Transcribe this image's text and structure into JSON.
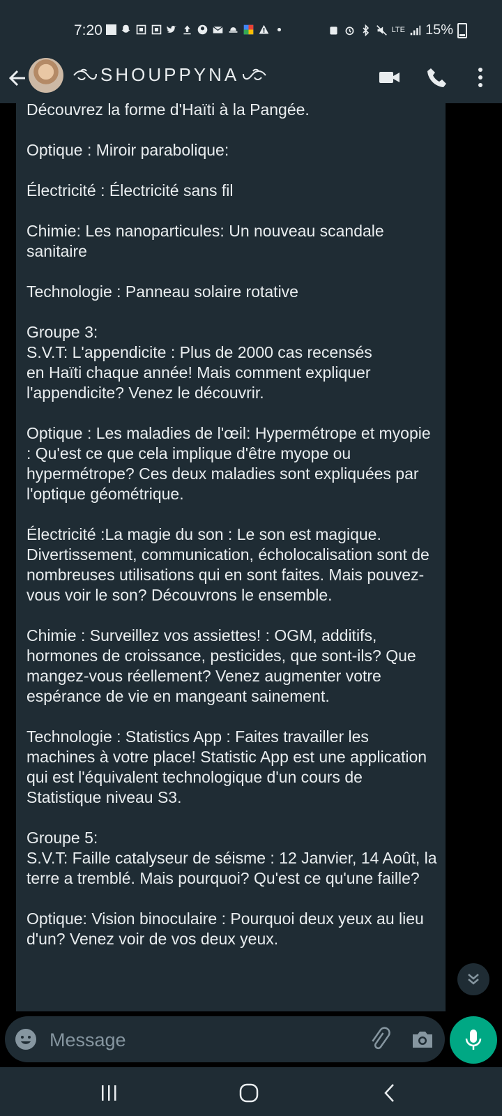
{
  "status_bar": {
    "time": "7:20",
    "network": "LTE",
    "battery": "15%"
  },
  "chat_header": {
    "contact_name": "SHOUPPYNA",
    "icons": [
      "back-arrow-icon",
      "video-call-icon",
      "voice-call-icon",
      "more-options-icon"
    ]
  },
  "message": {
    "text": "Découvrez la forme d'Haïti à la Pangée.\n\nOptique : Miroir parabolique:\n\nÉlectricité : Électricité sans fil\n\nChimie: Les nanoparticules: Un nouveau scandale sanitaire\n\nTechnologie : Panneau solaire rotative\n\nGroupe 3:\nS.V.T: L'appendicite : Plus de 2000 cas recensés\nen Haïti chaque année! Mais comment expliquer l'appendicite? Venez le découvrir.\n\nOptique : Les maladies de l'œil: Hypermétrope et myopie : Qu'est ce que cela implique d'être myope ou hypermétrope? Ces deux maladies sont expliquées par l'optique géométrique.\n\nÉlectricité :La magie du son : Le son est magique. Divertissement, communication, écholocalisation sont de nombreuses utilisations qui en sont faites. Mais pouvez-vous voir le son? Découvrons le ensemble.\n\nChimie : Surveillez vos assiettes! : OGM, additifs, hormones de croissance, pesticides, que sont-ils? Que mangez-vous réellement? Venez augmenter votre espérance de vie en mangeant sainement.\n\nTechnologie : Statistics App : Faites travailler les machines à votre place! Statistic App est une application qui est l'équivalent technologique d'un cours de Statistique niveau S3.\n\nGroupe 5:\nS.V.T: Faille catalyseur de séisme : 12 Janvier, 14 Août, la terre a tremblé. Mais pourquoi? Qu'est ce qu'une faille?\n\nOptique: Vision binoculaire : Pourquoi deux yeux au lieu d'un? Venez voir de vos deux yeux."
  },
  "composer": {
    "placeholder": "Message"
  },
  "colors": {
    "panel": "#1f2c34",
    "background": "#000000",
    "accent": "#00a884",
    "text": "#e9edef",
    "muted": "#8696a0"
  }
}
